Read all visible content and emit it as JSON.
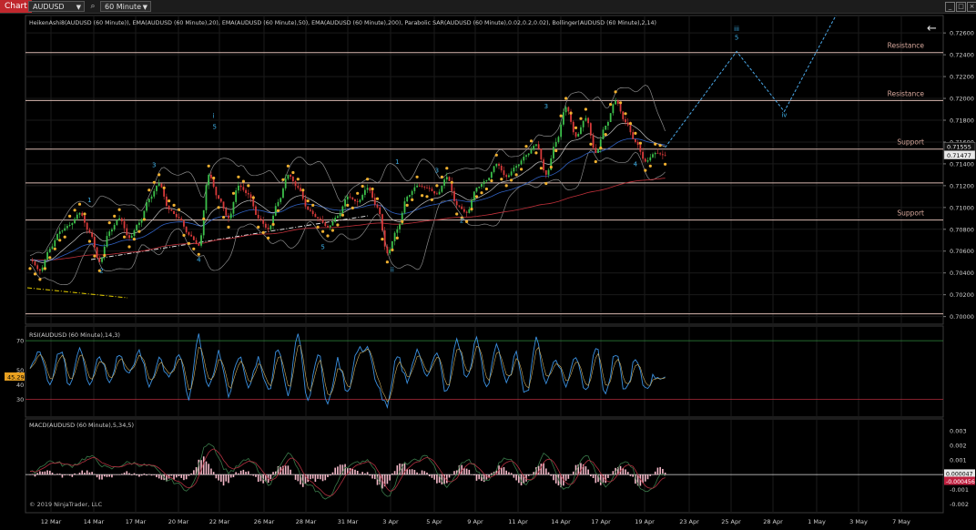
{
  "toolbar": {
    "chart_tab": "Chart",
    "instrument": "AUDUSD",
    "interval": "60 Minute"
  },
  "price_panel": {
    "indicators_label": "HeikenAshi8(AUDUSD (60 Minute)), EMA(AUDUSD (60 Minute),20), EMA(AUDUSD (60 Minute),50), EMA(AUDUSD (60 Minute),200), Parabolic SAR(AUDUSD (60 Minute),0.02,0.2,0.02), Bollinger(AUDUSD (60 Minute),2,14)",
    "y_ticks": [
      "0.72600",
      "0.72400",
      "0.72200",
      "0.72000",
      "0.71800",
      "0.71600",
      "0.71400",
      "0.71200",
      "0.71000",
      "0.70800",
      "0.70600",
      "0.70400",
      "0.70200",
      "0.70000"
    ],
    "y_tick_values": [
      0.726,
      0.724,
      0.722,
      0.72,
      0.718,
      0.716,
      0.714,
      0.712,
      0.71,
      0.708,
      0.706,
      0.704,
      0.702,
      0.7
    ],
    "ylim": [
      0.6993,
      0.7276
    ],
    "price_badges": [
      "0.71555",
      "0.71477"
    ],
    "price_badge_values": [
      0.71555,
      0.71477
    ],
    "levels": [
      {
        "label": "Resistance",
        "value": 0.7242
      },
      {
        "label": "Resistance",
        "value": 0.7198
      },
      {
        "label": "Support",
        "value": 0.71535
      },
      {
        "label": "",
        "value": 0.71225
      },
      {
        "label": "Support",
        "value": 0.70885
      },
      {
        "label": "",
        "value": 0.70025
      }
    ],
    "wave_labels": [
      {
        "text": "1",
        "date_index": 6.0,
        "value": 0.7105
      },
      {
        "text": "2",
        "date_index": 7.2,
        "value": 0.704
      },
      {
        "text": "3",
        "date_index": 12.5,
        "value": 0.7137
      },
      {
        "text": "4",
        "date_index": 17.0,
        "value": 0.705
      },
      {
        "text": "i",
        "date_index": 18.5,
        "value": 0.7182
      },
      {
        "text": "5",
        "date_index": 18.6,
        "value": 0.7172
      },
      {
        "text": "ii",
        "date_index": 36.5,
        "value": 0.7041
      },
      {
        "text": "1",
        "date_index": 37.0,
        "value": 0.714
      },
      {
        "text": "3",
        "date_index": 41.0,
        "value": 0.7132
      },
      {
        "text": "5",
        "date_index": 29.5,
        "value": 0.7062
      },
      {
        "text": "2",
        "date_index": 43.5,
        "value": 0.7086
      },
      {
        "text": "3",
        "date_index": 52.0,
        "value": 0.7191
      },
      {
        "text": "4",
        "date_index": 61.0,
        "value": 0.7138
      },
      {
        "text": "iii",
        "date_index": 71.2,
        "value": 0.7262
      },
      {
        "text": "5",
        "date_index": 71.2,
        "value": 0.7254
      },
      {
        "text": "iv",
        "date_index": 76.0,
        "value": 0.7183
      }
    ],
    "projection": [
      {
        "date_index": 64.0,
        "value": 0.7155
      },
      {
        "date_index": 71.2,
        "value": 0.7243
      },
      {
        "date_index": 76.0,
        "value": 0.7188
      },
      {
        "date_index": 81.2,
        "value": 0.7276
      }
    ]
  },
  "rsi_panel": {
    "label": "RSI(AUDUSD (60 Minute),14,3)",
    "y_ticks": [
      "70",
      "50",
      "40",
      "30"
    ],
    "y_tick_values": [
      70,
      50,
      40,
      30
    ],
    "ylim": [
      18,
      80
    ],
    "current": "45.29",
    "current_value": 45.29,
    "overbought": 70,
    "oversold": 30
  },
  "macd_panel": {
    "label": "MACD(AUDUSD (60 Minute),5,34,5)",
    "y_ticks": [
      "0.003",
      "0.002",
      "0.001",
      "-0.001",
      "-0.002"
    ],
    "y_tick_values": [
      0.003,
      0.002,
      0.001,
      -0.001,
      -0.002
    ],
    "ylim": [
      -0.0026,
      0.0038
    ],
    "badges": [
      "0.000047",
      "-0.000456"
    ],
    "badge_values": [
      4.7e-05,
      -0.000456
    ],
    "copyright": "© 2019 NinjaTrader, LLC"
  },
  "x_axis": {
    "labels": [
      "12 Mar",
      "14 Mar",
      "17 Mar",
      "20 Mar",
      "22 Mar",
      "26 Mar",
      "28 Mar",
      "31 Mar",
      "3 Apr",
      "5 Apr",
      "9 Apr",
      "11 Apr",
      "14 Apr",
      "17 Apr",
      "19 Apr",
      "23 Apr",
      "25 Apr",
      "28 Apr",
      "1 May",
      "3 May",
      "7 May"
    ]
  },
  "chart_data": {
    "type": "line",
    "x": [
      "12 Mar",
      "14 Mar",
      "17 Mar",
      "20 Mar",
      "22 Mar",
      "26 Mar",
      "28 Mar",
      "31 Mar",
      "3 Apr",
      "5 Apr",
      "9 Apr",
      "11 Apr",
      "14 Apr",
      "17 Apr",
      "19 Apr",
      "23 Apr",
      "25 Apr",
      "28 Apr",
      "1 May",
      "3 May",
      "7 May"
    ],
    "price_key_points": [
      [
        0,
        0.7052
      ],
      [
        1,
        0.7042
      ],
      [
        2,
        0.7062
      ],
      [
        3,
        0.7078
      ],
      [
        4,
        0.7084
      ],
      [
        5,
        0.7095
      ],
      [
        6,
        0.7077
      ],
      [
        7,
        0.705
      ],
      [
        8,
        0.7078
      ],
      [
        9,
        0.709
      ],
      [
        10,
        0.7072
      ],
      [
        11,
        0.7086
      ],
      [
        12,
        0.7108
      ],
      [
        13,
        0.7122
      ],
      [
        14,
        0.7098
      ],
      [
        15,
        0.709
      ],
      [
        16,
        0.7075
      ],
      [
        17,
        0.7065
      ],
      [
        18,
        0.713
      ],
      [
        19,
        0.7108
      ],
      [
        20,
        0.709
      ],
      [
        21,
        0.712
      ],
      [
        22,
        0.7112
      ],
      [
        23,
        0.709
      ],
      [
        24,
        0.708
      ],
      [
        25,
        0.7105
      ],
      [
        26,
        0.713
      ],
      [
        27,
        0.7118
      ],
      [
        28,
        0.7098
      ],
      [
        29,
        0.709
      ],
      [
        30,
        0.7082
      ],
      [
        31,
        0.7092
      ],
      [
        32,
        0.711
      ],
      [
        33,
        0.7105
      ],
      [
        34,
        0.7118
      ],
      [
        35,
        0.71
      ],
      [
        36,
        0.7058
      ],
      [
        37,
        0.708
      ],
      [
        38,
        0.711
      ],
      [
        39,
        0.712
      ],
      [
        40,
        0.7118
      ],
      [
        41,
        0.7112
      ],
      [
        42,
        0.7128
      ],
      [
        43,
        0.7102
      ],
      [
        44,
        0.7095
      ],
      [
        45,
        0.7118
      ],
      [
        46,
        0.7125
      ],
      [
        47,
        0.714
      ],
      [
        48,
        0.7128
      ],
      [
        49,
        0.7138
      ],
      [
        50,
        0.7148
      ],
      [
        51,
        0.7158
      ],
      [
        52,
        0.713
      ],
      [
        53,
        0.716
      ],
      [
        54,
        0.7192
      ],
      [
        55,
        0.7165
      ],
      [
        56,
        0.7182
      ],
      [
        57,
        0.715
      ],
      [
        58,
        0.7175
      ],
      [
        59,
        0.7198
      ],
      [
        60,
        0.7178
      ],
      [
        61,
        0.716
      ],
      [
        62,
        0.7142
      ],
      [
        63,
        0.715
      ],
      [
        64,
        0.71477
      ]
    ],
    "rsi_key_points": [
      [
        0,
        52
      ],
      [
        1,
        62
      ],
      [
        2,
        38
      ],
      [
        3,
        64
      ],
      [
        4,
        40
      ],
      [
        5,
        66
      ],
      [
        6,
        42
      ],
      [
        7,
        60
      ],
      [
        8,
        44
      ],
      [
        9,
        61
      ],
      [
        10,
        46
      ],
      [
        11,
        63
      ],
      [
        12,
        40
      ],
      [
        13,
        58
      ],
      [
        14,
        44
      ],
      [
        15,
        60
      ],
      [
        16,
        30
      ],
      [
        17,
        72
      ],
      [
        18,
        36
      ],
      [
        19,
        62
      ],
      [
        20,
        34
      ],
      [
        21,
        60
      ],
      [
        22,
        38
      ],
      [
        23,
        58
      ],
      [
        24,
        36
      ],
      [
        25,
        66
      ],
      [
        26,
        32
      ],
      [
        27,
        76
      ],
      [
        28,
        30
      ],
      [
        29,
        62
      ],
      [
        30,
        26
      ],
      [
        31,
        56
      ],
      [
        32,
        36
      ],
      [
        33,
        63
      ],
      [
        34,
        66
      ],
      [
        35,
        38
      ],
      [
        36,
        26
      ],
      [
        37,
        58
      ],
      [
        38,
        44
      ],
      [
        39,
        62
      ],
      [
        40,
        48
      ],
      [
        41,
        60
      ],
      [
        42,
        34
      ],
      [
        43,
        71
      ],
      [
        44,
        44
      ],
      [
        45,
        70
      ],
      [
        46,
        38
      ],
      [
        47,
        68
      ],
      [
        48,
        40
      ],
      [
        49,
        60
      ],
      [
        50,
        34
      ],
      [
        51,
        70
      ],
      [
        52,
        42
      ],
      [
        53,
        58
      ],
      [
        54,
        40
      ],
      [
        55,
        60
      ],
      [
        56,
        36
      ],
      [
        57,
        66
      ],
      [
        58,
        34
      ],
      [
        59,
        60
      ],
      [
        60,
        36
      ],
      [
        61,
        56
      ],
      [
        62,
        38
      ],
      [
        63,
        46
      ],
      [
        64,
        45.29
      ]
    ],
    "macd_key_points": [
      [
        0,
        0.0001
      ],
      [
        2,
        0.0009
      ],
      [
        4,
        0.0006
      ],
      [
        6,
        0.0012
      ],
      [
        8,
        0.0004
      ],
      [
        10,
        0.0008
      ],
      [
        12,
        0.0006
      ],
      [
        14,
        -0.0004
      ],
      [
        16,
        -0.001
      ],
      [
        18,
        0.0022
      ],
      [
        20,
        0.0002
      ],
      [
        22,
        0.001
      ],
      [
        24,
        -0.0006
      ],
      [
        26,
        0.0014
      ],
      [
        28,
        -0.0008
      ],
      [
        30,
        -0.0016
      ],
      [
        32,
        0.0006
      ],
      [
        34,
        0.001
      ],
      [
        36,
        -0.0014
      ],
      [
        38,
        0.0008
      ],
      [
        40,
        0.0012
      ],
      [
        42,
        -0.0008
      ],
      [
        44,
        0.001
      ],
      [
        46,
        -0.0004
      ],
      [
        48,
        0.0012
      ],
      [
        50,
        -0.0006
      ],
      [
        52,
        0.0014
      ],
      [
        54,
        -0.001
      ],
      [
        56,
        0.0012
      ],
      [
        58,
        -0.0008
      ],
      [
        60,
        0.001
      ],
      [
        62,
        -0.0012
      ],
      [
        64,
        4.7e-05
      ]
    ],
    "ylim_price": [
      0.6993,
      0.7276
    ]
  }
}
